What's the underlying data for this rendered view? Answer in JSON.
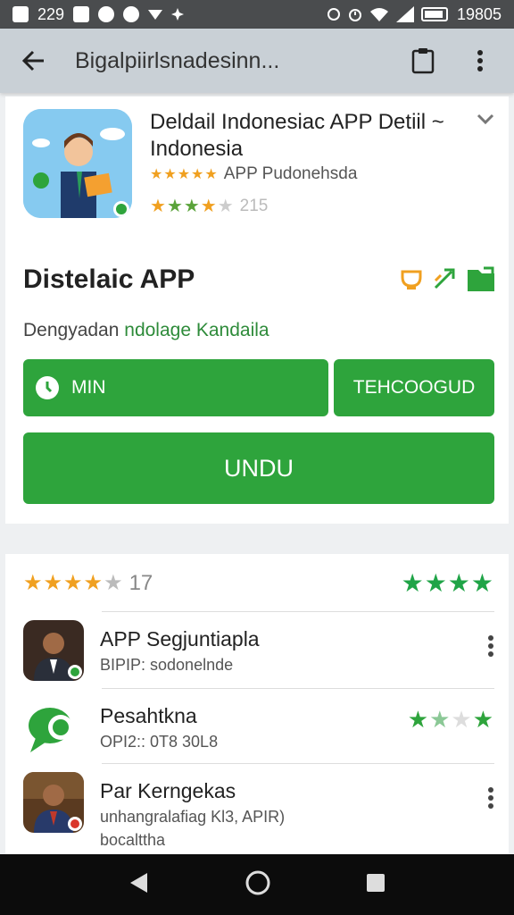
{
  "status_bar": {
    "left_text": "229",
    "right_text": "19805"
  },
  "app_bar": {
    "title": "Bigalpiirlsnadesinn...",
    "back_icon": "arrow-back-icon",
    "clipboard_icon": "clipboard-icon",
    "more_icon": "more-vert-icon"
  },
  "app": {
    "title": "Deldail Indonesiac APP Detiil ~ Indonesia",
    "developer_stars": "★★★★★",
    "developer": "APP Pudonehsda",
    "rating_stars": "★★★★★",
    "rating_value": "215"
  },
  "section": {
    "title": "Distelaic APP",
    "description_prefix": "Dengyadan",
    "description_highlight": "ndolage Kandaila"
  },
  "buttons": {
    "min_label": "MIN",
    "tech_label": "TEHCOOGUD",
    "install_label": "UNDU"
  },
  "ratings_summary": {
    "stars": "★★★★★",
    "count": "17",
    "green_stars": "★★★★"
  },
  "reviews": [
    {
      "name": "APP Segjuntiapla",
      "subtitle": "BIPIP: sodonelnde",
      "subtitle2": ""
    },
    {
      "name": "Pesahtkna",
      "subtitle": "OPI2:: 0T8 30L8",
      "subtitle2": "",
      "stars": "★★★★"
    },
    {
      "name": "Par Kerngekas",
      "subtitle": "unhangralafiag Kl3, APIR)",
      "subtitle2": "bocalttha"
    }
  ],
  "colors": {
    "accent": "#2ea43c",
    "app_bar": "#c9d0d6",
    "star_orange": "#f0a020",
    "star_green": "#1fa447"
  }
}
